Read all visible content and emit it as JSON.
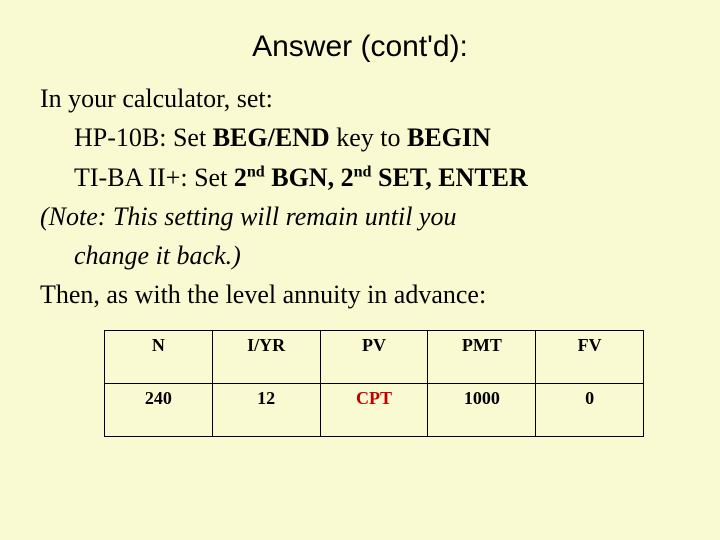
{
  "title": "Answer (cont'd):",
  "body": {
    "lead": "In your calculator, set:",
    "hp_label": "HP-10B: Set ",
    "hp_key": "BEG/END",
    "hp_mid": " key to ",
    "hp_val": "BEGIN",
    "ti_label": "TI-BA II+: Set ",
    "ti_k1a": "2",
    "ti_k1b": "nd",
    "ti_k1c": " BGN, 2",
    "ti_k1d": "nd",
    "ti_k1e": " SET, ENTER",
    "note_l1": "(Note: This setting will remain until you",
    "note_l2": "change it back.)",
    "then": "Then, as with the level annuity in advance:"
  },
  "chart_data": {
    "type": "table",
    "columns": [
      "N",
      "I/YR",
      "PV",
      "PMT",
      "FV"
    ],
    "rows": [
      {
        "N": "240",
        "I/YR": "12",
        "PV": "CPT",
        "PMT": "1000",
        "FV": "0"
      }
    ],
    "highlight_cell": {
      "row": 0,
      "col": "PV",
      "color": "#c00000"
    }
  }
}
